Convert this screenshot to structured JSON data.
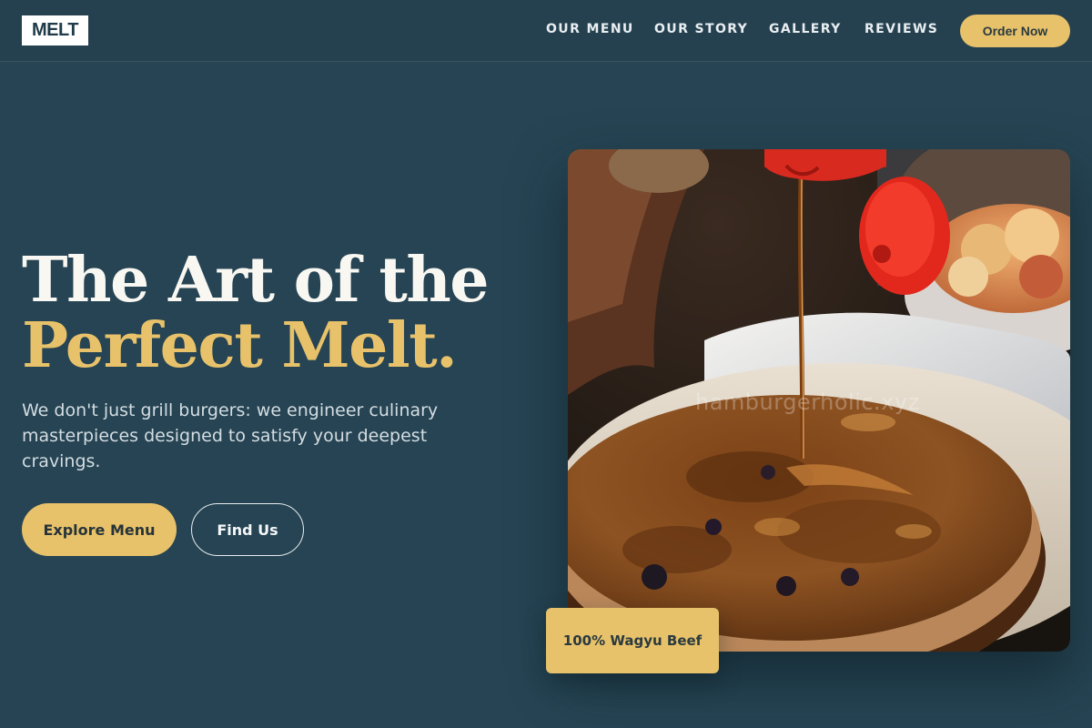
{
  "brand": {
    "logo": "MELT"
  },
  "nav": {
    "items": [
      {
        "label": "OUR MENU"
      },
      {
        "label": "OUR STORY"
      },
      {
        "label": "GALLERY"
      },
      {
        "label": "REVIEWS"
      }
    ],
    "cta_label": "Order Now"
  },
  "hero": {
    "title_line1": "The Art of the",
    "title_line2": "Perfect Melt.",
    "subtitle": "We don't just grill burgers: we engineer culinary masterpieces designed to satisfy your deepest cravings.",
    "primary_button": "Explore Menu",
    "secondary_button": "Find Us",
    "image_watermark": "hamburgerholic.xyz",
    "badge": "100% Wagyu Beef"
  },
  "colors": {
    "background": "#264453",
    "accent": "#e8c26a",
    "heading": "#f8f7f2",
    "body_text": "#d4dde2"
  }
}
